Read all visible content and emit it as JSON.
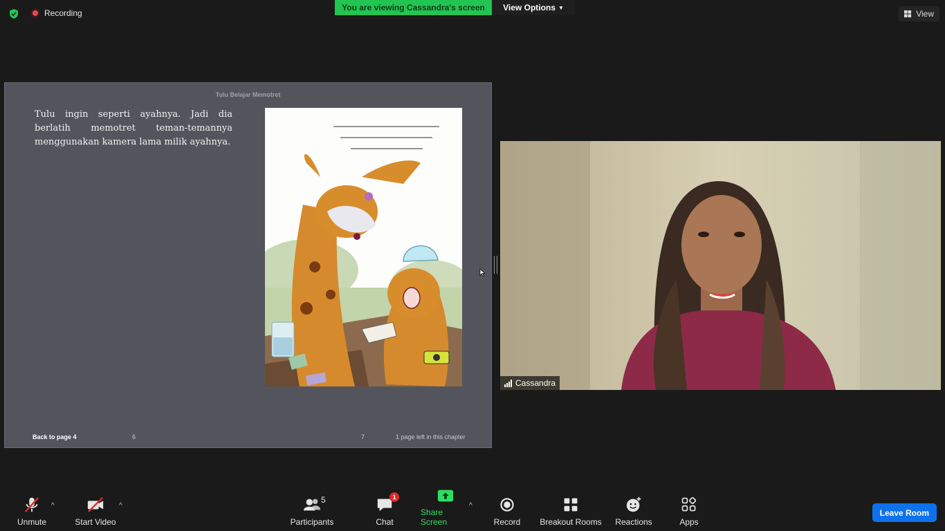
{
  "top": {
    "recording_label": "Recording",
    "banner_text": "You are viewing Cassandra's screen",
    "view_options_label": "View Options",
    "view_label": "View"
  },
  "share": {
    "book_title": "Tulu Belajar Memotret",
    "body_text": "Tulu ingin seperti ayahnya. Jadi dia berlatih memotret teman-temannya menggunakan kamera lama milik ayahnya.",
    "footer": {
      "back": "Back to page 4",
      "left_page": "6",
      "right_page": "7",
      "remaining": "1 page left in this chapter"
    }
  },
  "video": {
    "participant_name": "Cassandra"
  },
  "toolbar": {
    "unmute": "Unmute",
    "start_video": "Start Video",
    "participants": "Participants",
    "participants_count": "5",
    "chat": "Chat",
    "chat_badge": "1",
    "share_screen": "Share Screen",
    "record": "Record",
    "breakout_rooms": "Breakout Rooms",
    "reactions": "Reactions",
    "apps": "Apps",
    "leave": "Leave Room"
  },
  "colors": {
    "background": "#1a1a1a",
    "banner_green": "#23c552",
    "share_green": "#2fdd5e",
    "leave_blue": "#0e72ed",
    "badge_red": "#e02828"
  }
}
